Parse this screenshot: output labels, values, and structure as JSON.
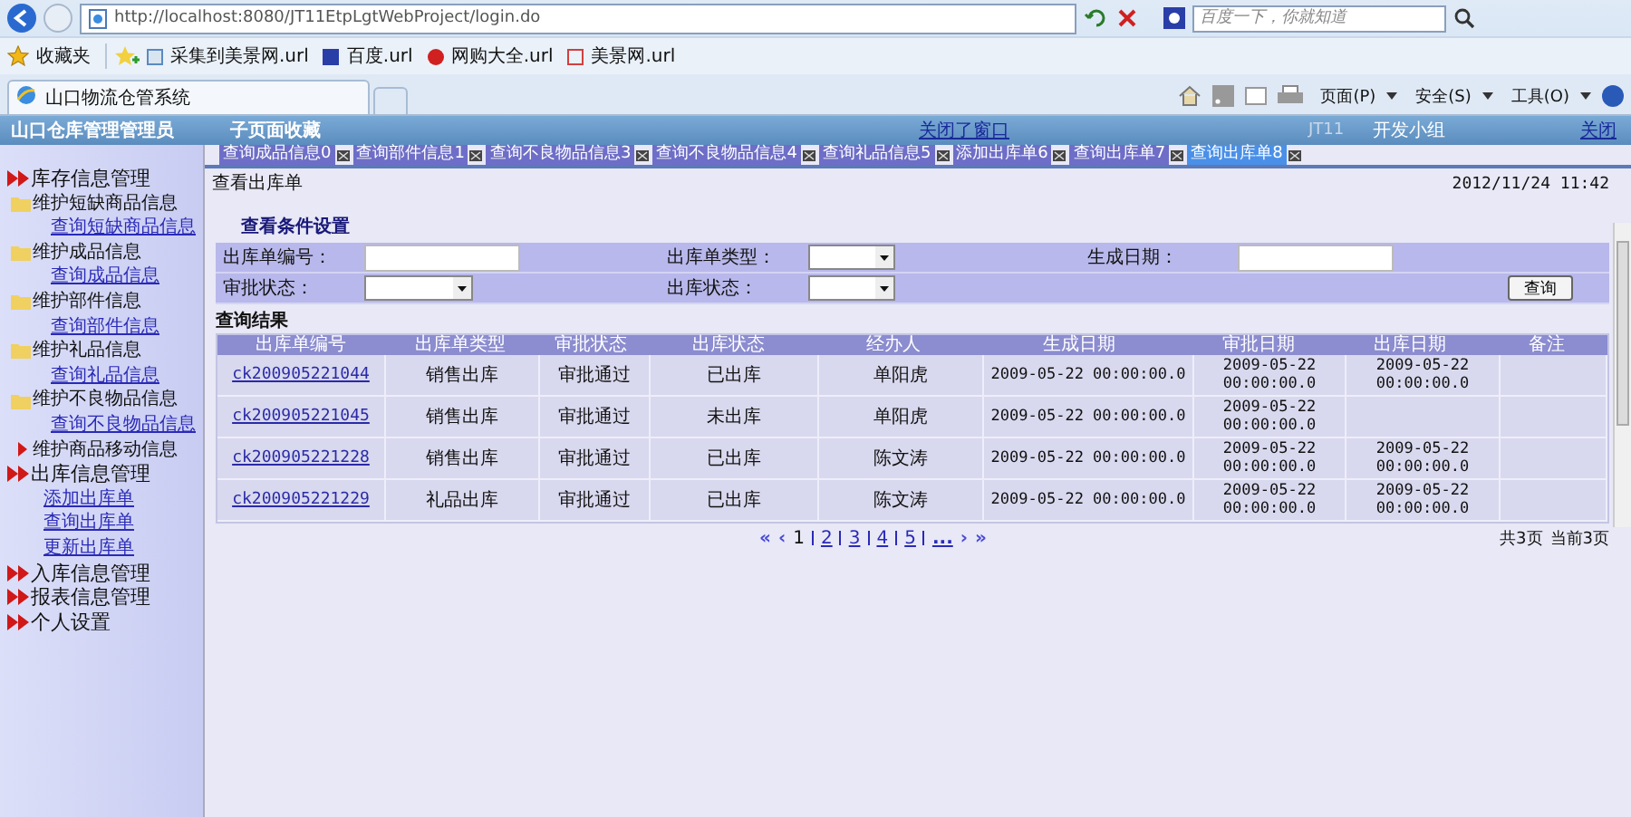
{
  "browser": {
    "address": "http://localhost:8080/JT11EtpLgtWebProject/login.do",
    "search_placeholder": "百度一下，你就知道",
    "favorites_label": "收藏夹",
    "favorites": [
      "采集到美景网.url",
      "百度.url",
      "网购大全.url",
      "美景网.url"
    ],
    "tab_title": "山口物流仓管系统",
    "menus": [
      "页面(P)",
      "安全(S)",
      "工具(O)"
    ]
  },
  "header": {
    "user": "山口仓库管理管理员",
    "subtitle": "子页面收藏",
    "close_all": "关闭了窗口",
    "team_code": "JT11",
    "team": "开发小组",
    "close": "关闭"
  },
  "page_tabs": [
    {
      "label": "查询成品信息0",
      "selected": false
    },
    {
      "label": "查询部件信息1",
      "selected": false
    },
    {
      "label": "查询不良物品信息3",
      "selected": false
    },
    {
      "label": "查询不良物品信息4",
      "selected": false
    },
    {
      "label": "查询礼品信息5",
      "selected": false
    },
    {
      "label": "添加出库单6",
      "selected": false
    },
    {
      "label": "查询出库单7",
      "selected": false
    },
    {
      "label": "查询出库单8",
      "selected": true
    }
  ],
  "sidebar": {
    "items": [
      {
        "kind": "section",
        "label": "库存信息管理",
        "children": [
          {
            "kind": "folder",
            "label": "维护短缺商品信息",
            "children": [
              {
                "kind": "link",
                "label": "查询短缺商品信息"
              }
            ]
          },
          {
            "kind": "folder",
            "label": "维护成品信息",
            "children": [
              {
                "kind": "link",
                "label": "查询成品信息"
              }
            ]
          },
          {
            "kind": "folder",
            "label": "维护部件信息",
            "children": [
              {
                "kind": "link",
                "label": "查询部件信息"
              }
            ]
          },
          {
            "kind": "folder",
            "label": "维护礼品信息",
            "children": [
              {
                "kind": "link",
                "label": "查询礼品信息"
              }
            ]
          },
          {
            "kind": "folder",
            "label": "维护不良物品信息",
            "children": [
              {
                "kind": "link",
                "label": "查询不良物品信息"
              }
            ]
          },
          {
            "kind": "arrow",
            "label": "维护商品移动信息"
          }
        ]
      },
      {
        "kind": "section",
        "label": "出库信息管理",
        "children": [
          {
            "kind": "link",
            "label": "添加出库单"
          },
          {
            "kind": "link",
            "label": "查询出库单"
          },
          {
            "kind": "link",
            "label": "更新出库单"
          }
        ]
      },
      {
        "kind": "section",
        "label": "入库信息管理"
      },
      {
        "kind": "section",
        "label": "报表信息管理"
      },
      {
        "kind": "section",
        "label": "个人设置"
      }
    ]
  },
  "page_title": "查看出库单",
  "datetime": "2012/11/24 11:42",
  "search": {
    "title": "查看条件设置",
    "rows": [
      [
        {
          "label": "出库单编号：",
          "kind": "text"
        },
        {
          "label": "出库单类型：",
          "kind": "select"
        },
        {
          "label": "生成日期：",
          "kind": "text"
        }
      ],
      [
        {
          "label": "审批状态：",
          "kind": "select"
        },
        {
          "label": "出库状态：",
          "kind": "select"
        }
      ]
    ],
    "button": "查询"
  },
  "results": {
    "title": "查询结果",
    "columns": [
      "出库单编号",
      "出库单类型",
      "审批状态",
      "出库状态",
      "经办人",
      "生成日期",
      "审批日期",
      "出库日期",
      "备注"
    ],
    "rows": [
      [
        "ck200905221044",
        "销售出库",
        "审批通过",
        "已出库",
        "单阳虎",
        "2009-05-22 00:00:00.0",
        "2009-05-22 00:00:00.0",
        "2009-05-22 00:00:00.0"
      ],
      [
        "ck200905221045",
        "销售出库",
        "审批通过",
        "未出库",
        "单阳虎",
        "2009-05-22 00:00:00.0",
        "2009-05-22 00:00:00.0",
        ""
      ],
      [
        "ck200905221228",
        "销售出库",
        "审批通过",
        "已出库",
        "陈文涛",
        "2009-05-22 00:00:00.0",
        "2009-05-22 00:00:00.0",
        "2009-05-22 00:00:00.0"
      ],
      [
        "ck200905221229",
        "礼品出库",
        "审批通过",
        "已出库",
        "陈文涛",
        "2009-05-22 00:00:00.0",
        "2009-05-22 00:00:00.0",
        "2009-05-22 00:00:00.0"
      ]
    ]
  },
  "pagination": {
    "first": "«",
    "prev": "‹",
    "pages": [
      {
        "label": "1",
        "selected": true
      },
      {
        "label": "2",
        "selected": false
      },
      {
        "label": "3",
        "selected": false
      },
      {
        "label": "4",
        "selected": false
      },
      {
        "label": "5",
        "selected": false
      }
    ],
    "more": "...",
    "next": "›",
    "last": "»",
    "total": "共3页",
    "current": "当前3页"
  }
}
